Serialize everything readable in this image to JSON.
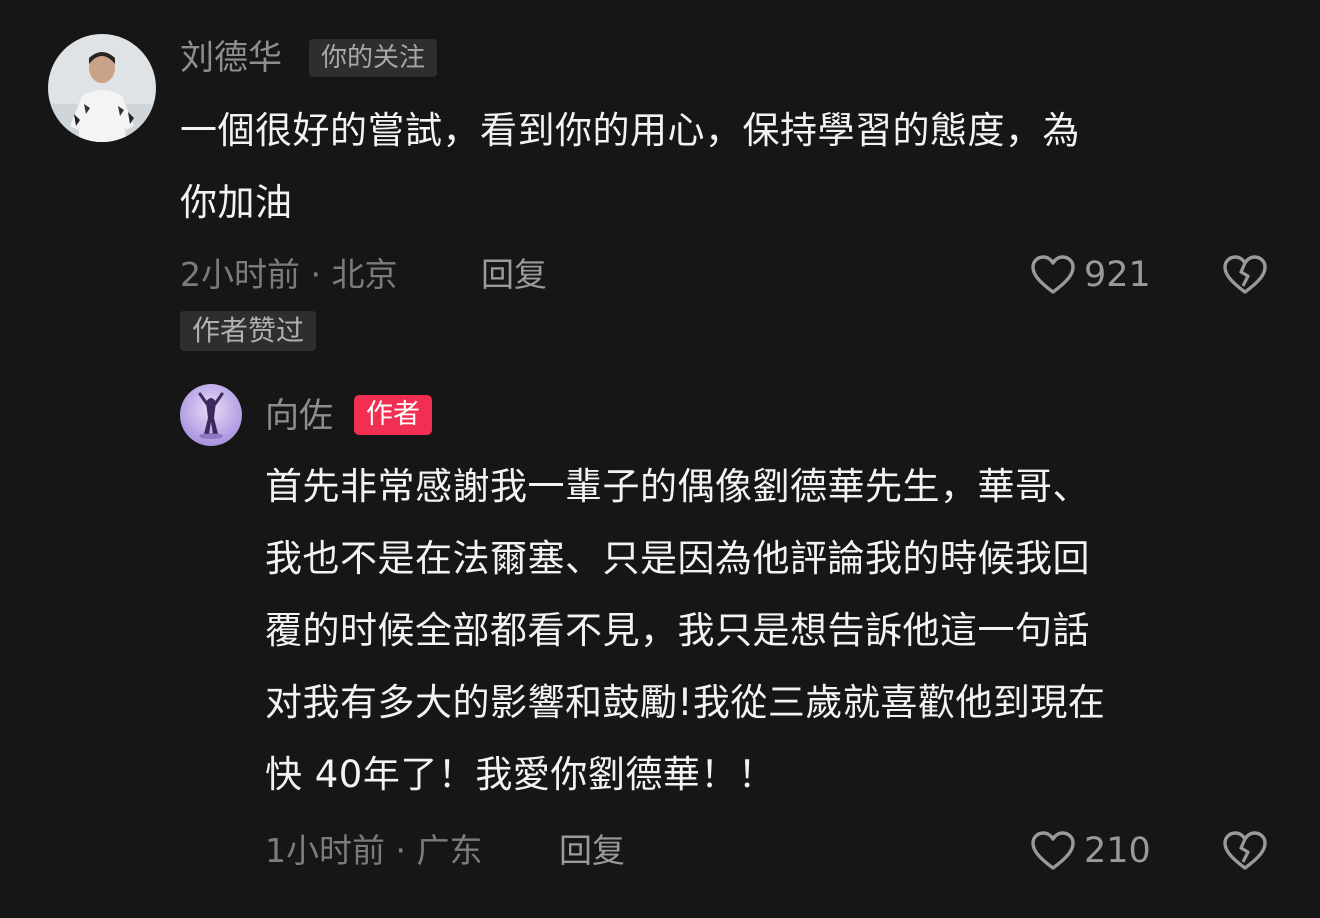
{
  "comments": [
    {
      "username": "刘德华",
      "tag": "你的关注",
      "text": "一個很好的嘗試，看到你的用心，保持學習的態度，為\n你加油",
      "time_location": "2小时前 · 北京",
      "reply_label": "回复",
      "like_count": "921",
      "badge": "作者赞过",
      "avatar_icon": "user-photo-avatar",
      "colors": {
        "avatar_bg": "#d9dee2",
        "shirt": "#f2f2f2"
      }
    },
    {
      "username": "向佐",
      "tag": "作者",
      "text": "首先非常感謝我一輩子的偶像劉德華先生，華哥、\n我也不是在法爾塞、只是因為他評論我的時候我回\n覆的时候全部都看不見，我只是想告訴他這一句話\n对我有多大的影響和鼓勵!我從三歲就喜歡他到現在\n快 40年了！我愛你劉德華！！",
      "time_location": "1小时前 · 广东",
      "reply_label": "回复",
      "like_count": "210",
      "avatar_icon": "user-photo-avatar",
      "colors": {
        "avatar_bg": "#b9a6e6",
        "tag_bg": "#f02f52"
      }
    }
  ],
  "icons": {
    "like": "heart-outline-icon",
    "dislike": "broken-heart-icon"
  },
  "colors": {
    "background": "#161616",
    "primary_text": "#f3f3f3",
    "secondary_text": "#8e8e8e",
    "author_tag": "#f02f52"
  }
}
